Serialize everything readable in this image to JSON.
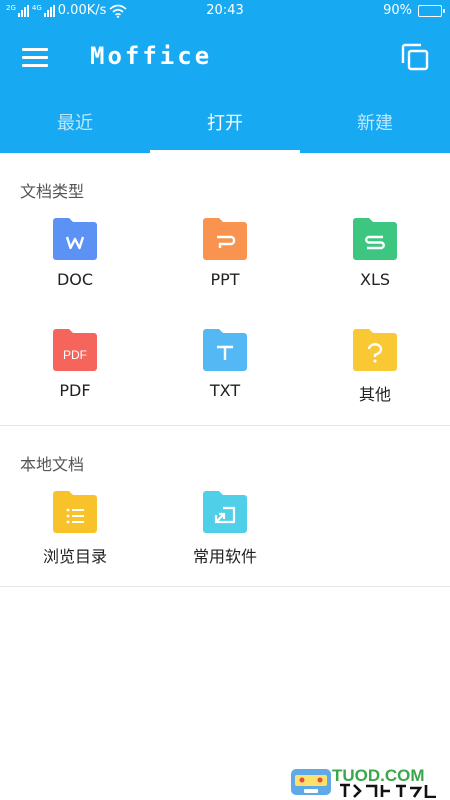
{
  "status_bar": {
    "signal_1_tag": "2G",
    "signal_2_tag": "4G",
    "net_speed": "0.00K/s",
    "time": "20:43",
    "battery_text": "90%",
    "battery_level": 0.9
  },
  "app": {
    "title": "Moffice"
  },
  "tabs": [
    {
      "label": "最近",
      "active": false
    },
    {
      "label": "打开",
      "active": true
    },
    {
      "label": "新建",
      "active": false
    }
  ],
  "doc_types": {
    "title": "文档类型",
    "items": [
      {
        "label": "DOC",
        "glyph": "W",
        "color": "#5b92f3"
      },
      {
        "label": "PPT",
        "glyph": "P",
        "color": "#f8944f"
      },
      {
        "label": "XLS",
        "glyph": "S",
        "color": "#3cc67f"
      },
      {
        "label": "PDF",
        "glyph": "PDF",
        "color": "#f5655b"
      },
      {
        "label": "TXT",
        "glyph": "T",
        "color": "#54b8f5"
      },
      {
        "label": "其他",
        "glyph": "?",
        "color": "#f8c935"
      }
    ]
  },
  "local_docs": {
    "title": "本地文档",
    "items": [
      {
        "label": "浏览目录",
        "icon": "list-icon",
        "color": "#f8c22b"
      },
      {
        "label": "常用软件",
        "icon": "shortcut-icon",
        "color": "#4fd0e8"
      }
    ]
  },
  "watermark": {
    "text": "TUOD.COM"
  },
  "colors": {
    "primary": "#18a9f3"
  }
}
